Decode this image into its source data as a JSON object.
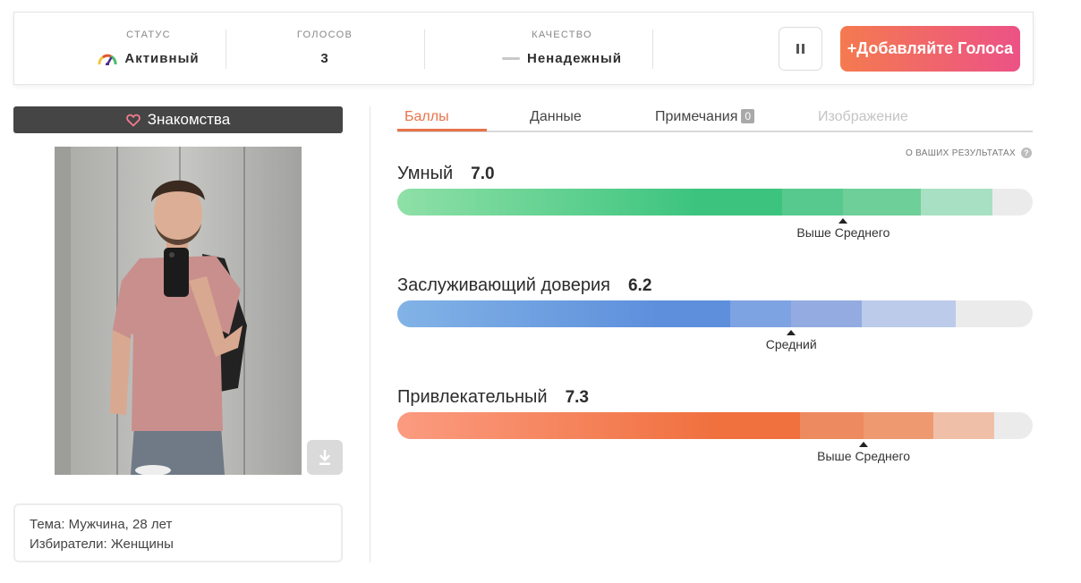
{
  "status_bar": {
    "status": {
      "label": "СТАТУС",
      "value": "Активный",
      "icon": "gauge-icon"
    },
    "votes": {
      "label": "ГОЛОСОВ",
      "value": "3"
    },
    "quality": {
      "label": "КАЧЕСТВО",
      "value": "Ненадежный",
      "icon": "dash-icon"
    },
    "pause_icon": "pause-icon",
    "add_button": "+Добавляйте Голоса"
  },
  "category": {
    "label": "Знакомства",
    "icon": "heart-icon"
  },
  "photo": {
    "description_icon": "person-photo"
  },
  "download_icon": "download-icon",
  "subject": {
    "line1": "Тема: Мужчина, 28 лет",
    "line2": "Избиратели: Женщины"
  },
  "tabs": [
    {
      "label": "Баллы",
      "state": "active"
    },
    {
      "label": "Данные",
      "state": "normal"
    },
    {
      "label": "Примечания",
      "badge": "0",
      "state": "normal"
    },
    {
      "label": "Изображение",
      "state": "disabled"
    }
  ],
  "about_results": "О ВАШИХ РЕЗУЛЬТАТАХ",
  "scores": [
    {
      "name": "Умный",
      "score": "7.0",
      "score_value": 7.0,
      "level": "Выше Среднего",
      "colors": [
        "#8fe0a7",
        "#3cc47e",
        "#58c98e",
        "#6ecf99",
        "#a8e0c3",
        "#c8eadb"
      ]
    },
    {
      "name": "Заслуживающий доверия",
      "score": "6.2",
      "score_value": 6.2,
      "level": "Средний",
      "colors": [
        "#82b3e6",
        "#5e8fdc",
        "#7ea3e2",
        "#93abe0",
        "#bccbe9",
        "#d2dbee"
      ]
    },
    {
      "name": "Привлекательный",
      "score": "7.3",
      "score_value": 7.3,
      "level": "Выше Среднего",
      "colors": [
        "#fb9b80",
        "#f0703e",
        "#ee8a60",
        "#ee9970",
        "#f0bfa8",
        "#f2d4c8"
      ]
    }
  ]
}
